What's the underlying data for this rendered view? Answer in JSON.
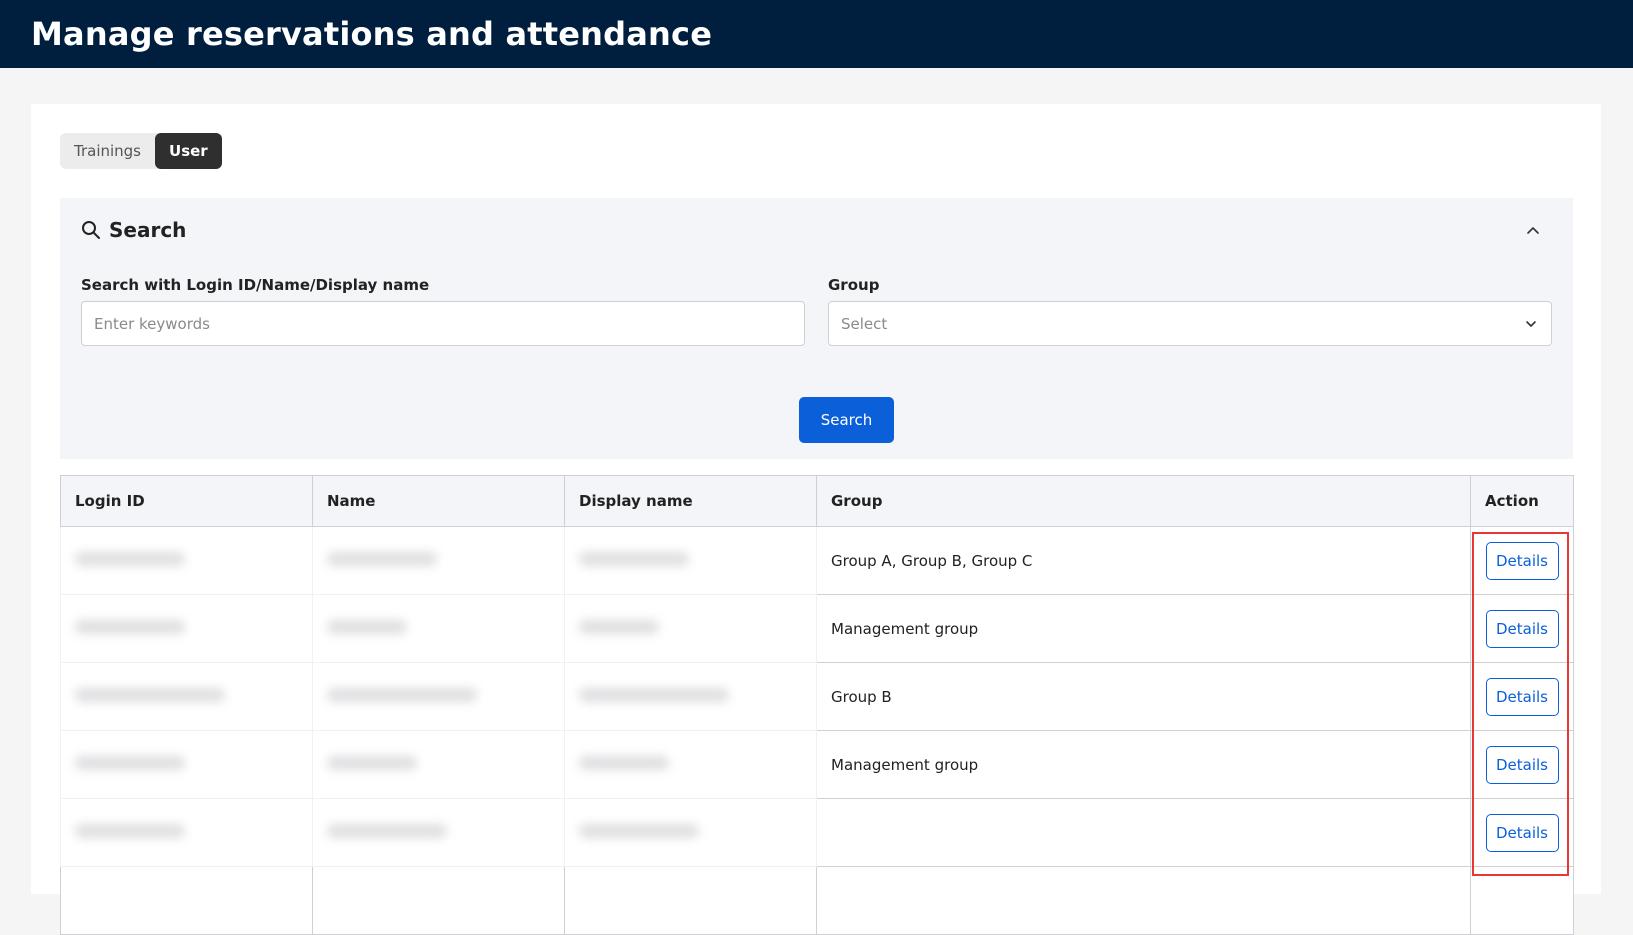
{
  "header": {
    "title": "Manage reservations and attendance"
  },
  "tabs": [
    {
      "label": "Trainings",
      "active": false
    },
    {
      "label": "User",
      "active": true
    }
  ],
  "search": {
    "title": "Search",
    "keyword_label": "Search with Login ID/Name/Display name",
    "keyword_placeholder": "Enter keywords",
    "group_label": "Group",
    "group_placeholder": "Select",
    "button_label": "Search"
  },
  "table": {
    "columns": [
      "Login ID",
      "Name",
      "Display name",
      "Group",
      "Action"
    ],
    "rows": [
      {
        "group": "Group A, Group B, Group C",
        "action": "Details"
      },
      {
        "group": "Management group",
        "action": "Details"
      },
      {
        "group": "Group B",
        "action": "Details"
      },
      {
        "group": "Management group",
        "action": "Details"
      },
      {
        "group": "",
        "action": "Details"
      }
    ]
  },
  "colors": {
    "header_bg": "#001f3f",
    "primary": "#0b5fd9",
    "highlight": "#e53935"
  }
}
